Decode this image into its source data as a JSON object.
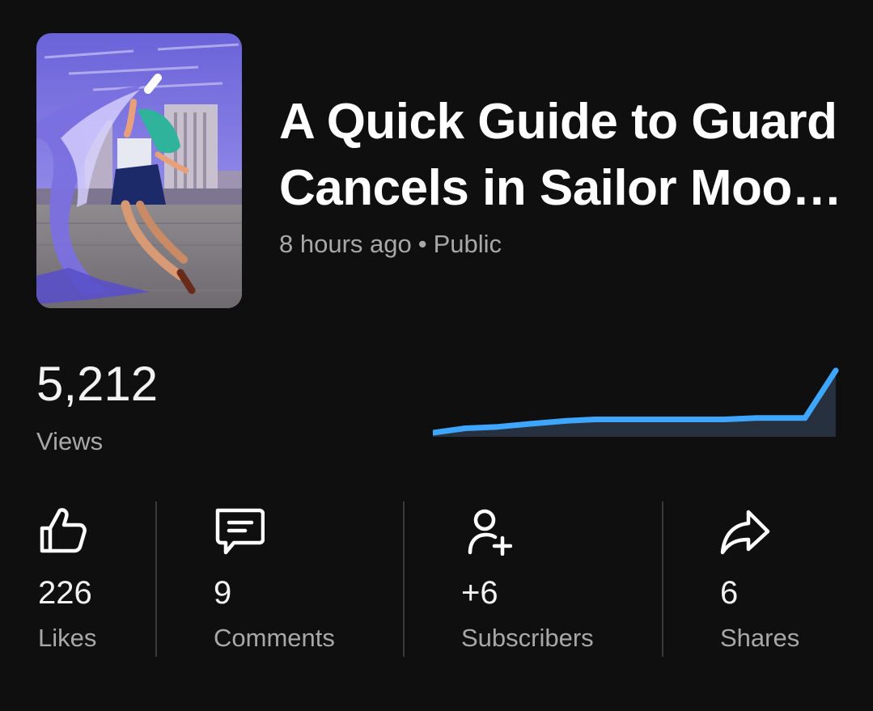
{
  "video": {
    "title": "A Quick Guide to Guard Cancels in Sailor Moon S",
    "time_ago": "8 hours ago",
    "separator": "•",
    "visibility": "Public",
    "thumbnail_icon": "video-thumbnail-image"
  },
  "views": {
    "count": "5,212",
    "label": "Views",
    "trend": [
      0,
      3,
      4,
      6,
      8,
      9,
      9,
      9,
      9,
      10,
      10,
      42
    ],
    "line_color": "#3ea6ff",
    "fill_color": "#26303f"
  },
  "stats": [
    {
      "icon": "thumbs-up-icon",
      "value": "226",
      "label": "Likes"
    },
    {
      "icon": "comment-icon",
      "value": "9",
      "label": "Comments"
    },
    {
      "icon": "add-person-icon",
      "value": "+6",
      "label": "Subscribers"
    },
    {
      "icon": "share-icon",
      "value": "6",
      "label": "Shares"
    }
  ]
}
